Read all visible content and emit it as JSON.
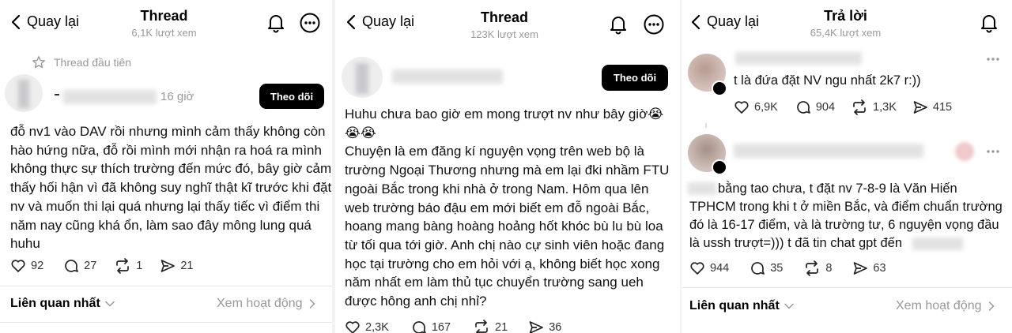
{
  "panel1": {
    "back_label": "Quay lại",
    "title": "Thread",
    "views": "6,1K lượt xem",
    "pinned_label": "Thread đầu tiên",
    "post_time": "16 giờ",
    "follow_label": "Theo dõi",
    "lines": [
      "đỗ nv1 vào DAV rồi nhưng mình cảm thấy không còn",
      "hào hứng nữa, đỗ rồi mình mới nhận ra hoá ra mình",
      "không thực sự thích trường đến mức đó, bây giờ cảm",
      "thấy hối hận vì đã không suy nghĩ thật kĩ trước khi đặt",
      "nv và muốn thi lại quá nhưng lại thấy tiếc vì điểm thi",
      "năm nay cũng khá ổn, làm sao đây mông lung quá",
      "huhu"
    ],
    "likes": "92",
    "comments": "27",
    "reposts": "1",
    "shares": "21",
    "related_label": "Liên quan nhất",
    "activity_label": "Xem hoạt động"
  },
  "panel2": {
    "back_label": "Quay lại",
    "title": "Thread",
    "views": "123K lượt xem",
    "follow_label": "Theo dõi",
    "lines": [
      "Huhu chưa bao giờ em mong trượt nv như bây giờ😭",
      "😭😭",
      "Chuyện là em đăng kí nguyện vọng trên web bộ là",
      "trường Ngoại Thương nhưng mà em lại đki nhầm FTU",
      "ngoài Bắc trong khi nhà ở trong Nam. Hôm qua lên",
      "web trường báo đậu em mới biết em đỗ ngoài Bắc,",
      "hoang mang bàng hoàng hoảng hốt khóc bù lu bù loa",
      "từ tối qua tới giờ. Anh chị nào cự sinh viên hoặc đang",
      "học tại trường cho em hỏi với ạ, không biết học xong",
      "năm nhất em làm thủ tục chuyển trường sang ueh",
      "được hông anh chị nhỉ?"
    ],
    "likes": "2,3K",
    "comments": "167",
    "reposts": "21",
    "shares": "36"
  },
  "panel3": {
    "back_label": "Quay lại",
    "title": "Trả lời",
    "views": "65,4K lượt xem",
    "reply1": {
      "text": "t là đứa đặt NV ngu nhất 2k7 r:))",
      "likes": "6,9K",
      "comments": "904",
      "reposts": "1,3K",
      "shares": "415"
    },
    "reply2": {
      "lines": [
        "bằng tao chưa, t đặt nv 7-8-9 là Văn Hiến",
        "TPHCM trong khi t ở miền Bắc, và điểm chuẩn trường",
        "đó là 16-17 điểm, và là trường tư, 6 nguyện vọng đầu",
        "là ussh trượt=))) t đã tin chat gpt đến"
      ],
      "likes": "944",
      "comments": "35",
      "reposts": "8",
      "shares": "63"
    },
    "related_label": "Liên quan nhất",
    "activity_label": "Xem hoạt động"
  }
}
